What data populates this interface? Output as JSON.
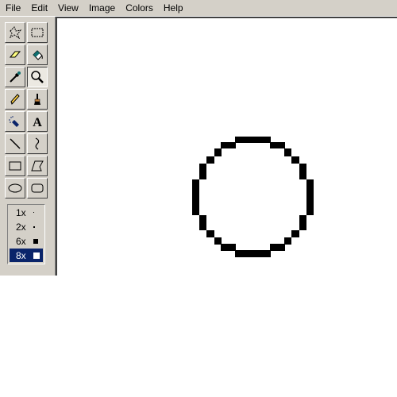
{
  "menu": [
    "File",
    "Edit",
    "View",
    "Image",
    "Colors",
    "Help"
  ],
  "tools": [
    {
      "name": "free-form-select-icon"
    },
    {
      "name": "select-icon"
    },
    {
      "name": "eraser-icon"
    },
    {
      "name": "fill-with-color-icon"
    },
    {
      "name": "pick-color-icon"
    },
    {
      "name": "magnifier-icon",
      "active": true
    },
    {
      "name": "pencil-icon"
    },
    {
      "name": "brush-icon"
    },
    {
      "name": "airbrush-icon"
    },
    {
      "name": "text-icon"
    },
    {
      "name": "line-icon"
    },
    {
      "name": "curve-icon"
    },
    {
      "name": "rectangle-icon"
    },
    {
      "name": "polygon-icon"
    },
    {
      "name": "ellipse-icon"
    },
    {
      "name": "rounded-rectangle-icon"
    }
  ],
  "zoom_options": [
    {
      "label": "1x"
    },
    {
      "label": "2x"
    },
    {
      "label": "6x"
    },
    {
      "label": "8x",
      "selected": true
    }
  ],
  "colors": {
    "face": "#d4d0c8",
    "selection": "#0a246a",
    "canvas": "#ffffff",
    "ink": "#000000"
  }
}
